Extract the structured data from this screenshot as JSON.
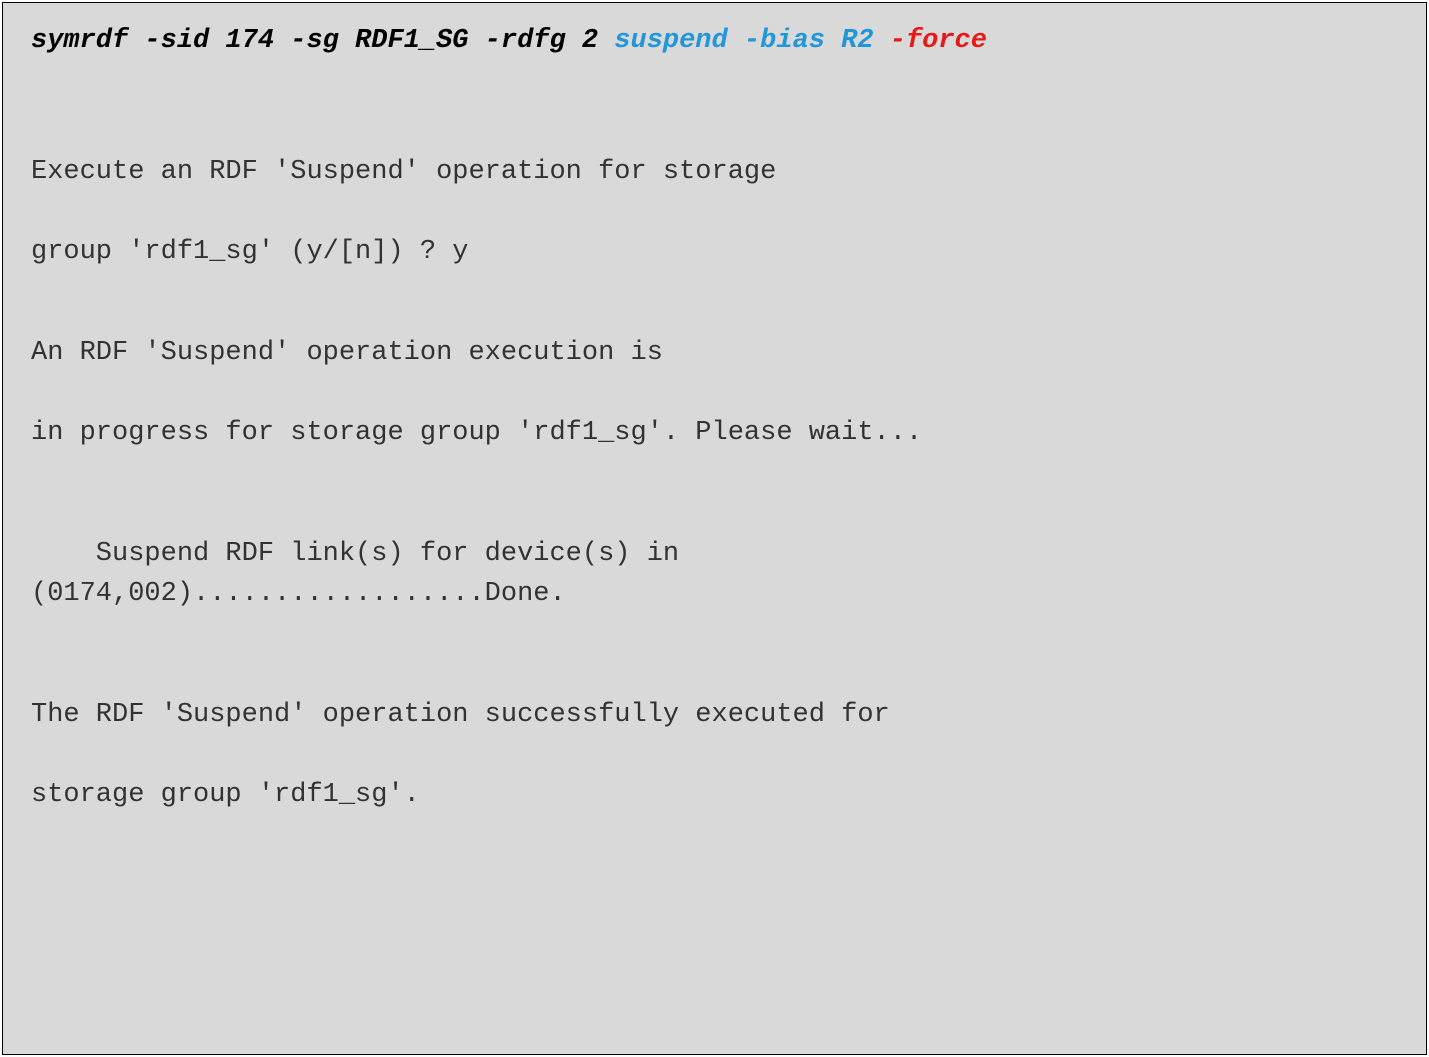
{
  "command": {
    "base": "symrdf -sid 174 -sg RDF1_SG -rdfg 2 ",
    "blue": "suspend -bias R2 ",
    "red": "-force"
  },
  "output": {
    "line1": "Execute an RDF 'Suspend' operation for storage",
    "line2": "group 'rdf1_sg' (y/[n]) ? y",
    "line3": "An RDF 'Suspend' operation execution is",
    "line4": "in progress for storage group 'rdf1_sg'. Please wait...",
    "line5": "    Suspend RDF link(s) for device(s) in",
    "line6": "(0174,002)..................Done.",
    "line7": "The RDF 'Suspend' operation successfully executed for",
    "line8": "storage group 'rdf1_sg'."
  }
}
